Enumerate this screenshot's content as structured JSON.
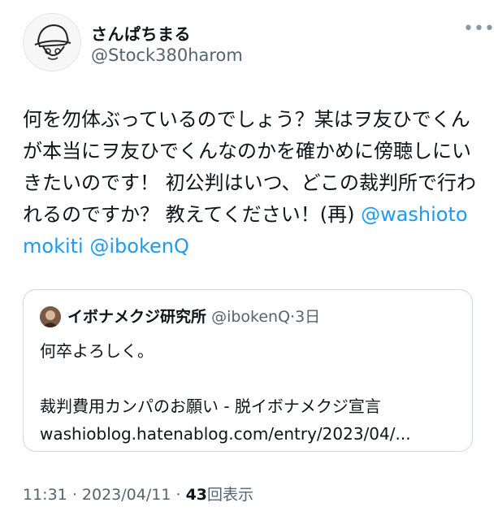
{
  "author": {
    "display_name": "さんぱちまる",
    "handle": "@Stock380harom"
  },
  "tweet": {
    "text": "何を勿体ぶっているのでしょう？某はヲ友ひでくんが本当にヲ友ひでくんなのかを確かめに傍聴しにいきたいのです！ 初公判はいつ、どこの裁判所で行われるのですか？ 教えてください！(再) ",
    "mention_1": "@washiotomokiti",
    "mention_2": "@ibokenQ"
  },
  "quoted": {
    "name": "イボナメクジ研究所",
    "handle": "@ibokenQ",
    "separator": "·",
    "age": "3日",
    "text": "何卒よろしく。",
    "link_title": "裁判費用カンパのお願い - 脱イボナメクジ宣言",
    "link_url": "washioblog.hatenablog.com/entry/2023/04/..."
  },
  "footer": {
    "time": "11:31",
    "separator": "·",
    "date": "2023/04/11",
    "views_count": "43",
    "views_label": "回表示"
  },
  "icons": {
    "more": "more-icon",
    "avatar": "avatar-image"
  }
}
